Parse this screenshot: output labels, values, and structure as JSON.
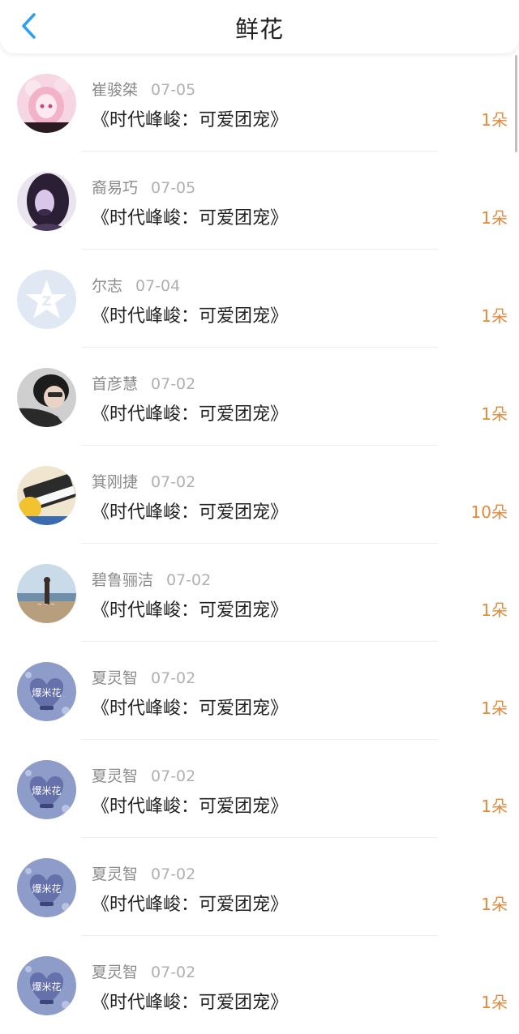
{
  "header": {
    "title": "鲜花",
    "back_icon": "chevron-left-icon",
    "accent_color": "#2ba0f0"
  },
  "rows": [
    {
      "name": "崔骏桀",
      "date": "07-05",
      "work": "《时代峰峻：可爱团宠》",
      "count": "1朵",
      "avatar": "anime-pink"
    },
    {
      "name": "裔易巧",
      "date": "07-05",
      "work": "《时代峰峻：可爱团宠》",
      "count": "1朵",
      "avatar": "dark-hair"
    },
    {
      "name": "尔志",
      "date": "07-04",
      "work": "《时代峰峻：可爱团宠》",
      "count": "1朵",
      "avatar": "default-star"
    },
    {
      "name": "首彦慧",
      "date": "07-02",
      "work": "《时代峰峻：可爱团宠》",
      "count": "1朵",
      "avatar": "selfie"
    },
    {
      "name": "箕刚捷",
      "date": "07-02",
      "work": "《时代峰峻：可爱团宠》",
      "count": "10朵",
      "avatar": "piano"
    },
    {
      "name": "碧鲁骊洁",
      "date": "07-02",
      "work": "《时代峰峻：可爱团宠》",
      "count": "1朵",
      "avatar": "beach"
    },
    {
      "name": "夏灵智",
      "date": "07-02",
      "work": "《时代峰峻：可爱团宠》",
      "count": "1朵",
      "avatar": "heart-flower"
    },
    {
      "name": "夏灵智",
      "date": "07-02",
      "work": "《时代峰峻：可爱团宠》",
      "count": "1朵",
      "avatar": "heart-flower"
    },
    {
      "name": "夏灵智",
      "date": "07-02",
      "work": "《时代峰峻：可爱团宠》",
      "count": "1朵",
      "avatar": "heart-flower"
    },
    {
      "name": "夏灵智",
      "date": "07-02",
      "work": "《时代峰峻：可爱团宠》",
      "count": "1朵",
      "avatar": "heart-flower"
    }
  ],
  "colors": {
    "count": "#e08a3c",
    "name": "#8a8a8a",
    "date": "#b0b0b0",
    "work": "#222222"
  },
  "avatar_text": "爆米花"
}
